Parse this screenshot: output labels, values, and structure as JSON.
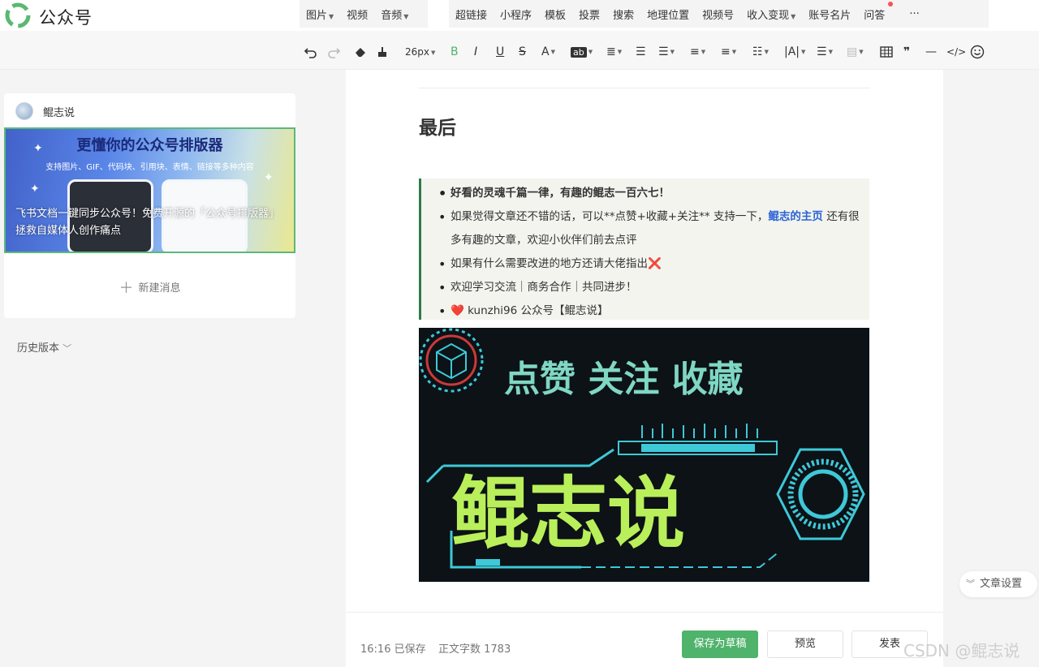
{
  "app": {
    "name": "公众号"
  },
  "menu": {
    "group1": [
      {
        "label": "图片",
        "caret": true
      },
      {
        "label": "视频",
        "caret": false
      },
      {
        "label": "音频",
        "caret": true
      }
    ],
    "group2": [
      {
        "label": "超链接",
        "caret": false
      },
      {
        "label": "小程序",
        "caret": false
      },
      {
        "label": "模板",
        "caret": false
      },
      {
        "label": "投票",
        "caret": false
      },
      {
        "label": "搜索",
        "caret": false
      },
      {
        "label": "地理位置",
        "caret": false
      },
      {
        "label": "视频号",
        "caret": false
      },
      {
        "label": "收入变现",
        "caret": true
      },
      {
        "label": "账号名片",
        "caret": false
      },
      {
        "label": "问答",
        "caret": false,
        "badge": true
      }
    ],
    "more": "···"
  },
  "toolbar": {
    "font_size": "26px",
    "ab_label": "ab"
  },
  "account": {
    "name": "鲲志说"
  },
  "cover": {
    "title": "更懂你的公众号排版器",
    "subtitle": "支持图片、GIF、代码块、引用块、表情、链接等多种内容",
    "caption": "飞书文档一键同步公众号！免费开源的「公众号排版器」拯救自媒体人创作痛点"
  },
  "new_message": "新建消息",
  "history": "历史版本",
  "article": {
    "heading": "最后",
    "bullets": {
      "b1": "好看的灵魂千篇一律，有趣的鲲志一百六七！",
      "b2_pre": "如果觉得文章还不错的话，可以**点赞+收藏+关注** 支持一下，",
      "b2_link": "鲲志的主页",
      "b2_post": " 还有很多有趣的文章，欢迎小伙伴们前去点评",
      "b3": "如果有什么需要改进的地方还请大佬指出",
      "b3_mark": "❌",
      "b4": "欢迎学习交流｜商务合作｜共同进步！",
      "b5_heart": "❤️",
      "b5": " kunzhi96 公众号【鲲志说】"
    },
    "banner": {
      "top_text": "点赞 关注 收藏",
      "main_text": "鲲志说"
    }
  },
  "footer": {
    "save_time": "16:16 已保存",
    "word_count": "正文字数 1783",
    "draft_button": "保存为草稿",
    "preview_button": "预览",
    "publish_button": "发表"
  },
  "article_settings": "文章设置",
  "watermark": "CSDN @鲲志说",
  "colors": {
    "accent_green": "#4fb36b",
    "link_blue": "#2c63d6",
    "quote_border": "#2f7a4a",
    "banner_green": "#b9ef5a",
    "banner_cyan": "#3ec8d8"
  }
}
